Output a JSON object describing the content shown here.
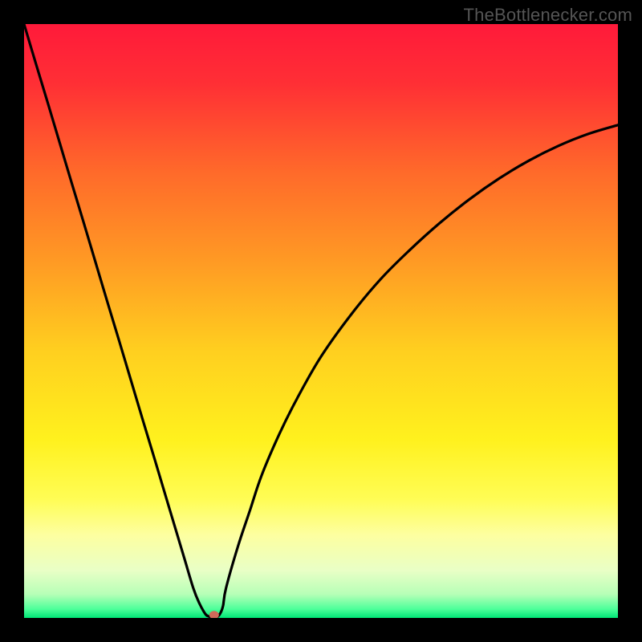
{
  "watermark": "TheBottlenecker.com",
  "chart_data": {
    "type": "line",
    "title": "",
    "xlabel": "",
    "ylabel": "",
    "xlim": [
      0,
      100
    ],
    "ylim": [
      0,
      100
    ],
    "gradient_stops": [
      {
        "offset": 0.0,
        "color": "#ff1a3a"
      },
      {
        "offset": 0.1,
        "color": "#ff2f35"
      },
      {
        "offset": 0.25,
        "color": "#ff6a2a"
      },
      {
        "offset": 0.4,
        "color": "#ff9a24"
      },
      {
        "offset": 0.55,
        "color": "#ffcf1f"
      },
      {
        "offset": 0.7,
        "color": "#fff11e"
      },
      {
        "offset": 0.8,
        "color": "#fffd55"
      },
      {
        "offset": 0.86,
        "color": "#fdffa0"
      },
      {
        "offset": 0.92,
        "color": "#e9ffc6"
      },
      {
        "offset": 0.96,
        "color": "#b7ffb7"
      },
      {
        "offset": 0.985,
        "color": "#4dff9a"
      },
      {
        "offset": 1.0,
        "color": "#00e676"
      }
    ],
    "series": [
      {
        "name": "bottleneck-curve",
        "x": [
          0.0,
          2.0,
          4.0,
          6.0,
          8.0,
          10.0,
          12.0,
          14.0,
          16.0,
          18.0,
          20.0,
          22.0,
          24.0,
          25.5,
          27.0,
          28.5,
          29.5,
          30.5,
          31.0,
          31.5,
          32.0,
          32.5,
          33.0,
          33.5,
          34.0,
          36.0,
          38.0,
          40.0,
          43.0,
          46.0,
          50.0,
          55.0,
          60.0,
          65.0,
          70.0,
          75.0,
          80.0,
          85.0,
          90.0,
          95.0,
          100.0
        ],
        "y": [
          100.0,
          93.3,
          86.7,
          80.0,
          73.3,
          66.7,
          60.0,
          53.3,
          46.7,
          40.0,
          33.3,
          26.7,
          20.0,
          15.0,
          10.0,
          5.0,
          2.5,
          0.7,
          0.3,
          0.2,
          0.2,
          0.2,
          0.7,
          2.0,
          5.0,
          12.0,
          18.0,
          24.0,
          31.0,
          37.0,
          44.0,
          51.0,
          57.0,
          62.0,
          66.5,
          70.5,
          74.0,
          77.0,
          79.5,
          81.5,
          83.0
        ]
      }
    ],
    "marker": {
      "x": 32.0,
      "y": 0.5,
      "color": "#d06a5a"
    }
  }
}
